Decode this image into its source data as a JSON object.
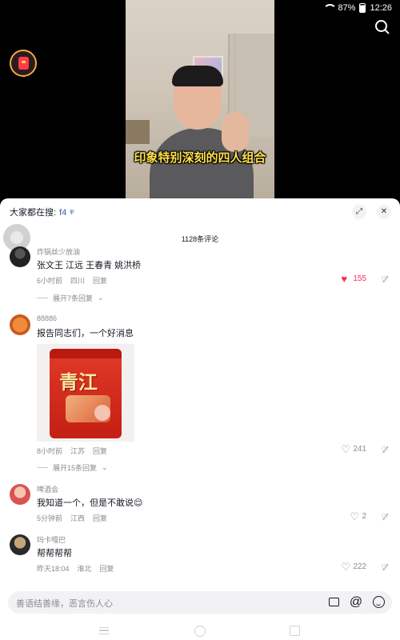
{
  "status": {
    "battery": "87%",
    "time": "12:26"
  },
  "video": {
    "subtitle": "印象特别深刻的四人组合"
  },
  "panel": {
    "search_prefix": "大家都在搜:",
    "search_keyword": "f4",
    "comment_count": "1128条评论"
  },
  "comments": [
    {
      "user": "炸锅丝少放油",
      "text": "张文王 江远 王春青 姚洪桥",
      "time": "6小时前",
      "location": "四川",
      "reply": "回复",
      "likes": "155",
      "liked": true,
      "expand": "展开7条回复"
    },
    {
      "user": "88886",
      "text": "报告同志们，一个好消息",
      "time": "8小时前",
      "location": "江苏",
      "reply": "回复",
      "likes": "241",
      "liked": false,
      "expand": "展开15条回复",
      "image_brand": "青江"
    },
    {
      "user": "啤酒会",
      "text": "我知道一个，但是不敢说😌",
      "time": "5分钟前",
      "location": "江西",
      "reply": "回复",
      "likes": "2",
      "liked": false
    },
    {
      "user": "玛卡嘎巴",
      "text": "帮帮帮帮",
      "time": "昨天18:04",
      "location": "淮北",
      "reply": "回复",
      "likes": "222",
      "liked": false
    }
  ],
  "input": {
    "placeholder": "善语结善缘，恶言伤人心"
  },
  "icons": {
    "heart_filled": "heart-icon",
    "heart_outline": "heart-outline-icon",
    "dislike": "dislike-icon",
    "image": "image-icon",
    "at": "at-icon",
    "emoji": "emoji-icon"
  },
  "colors": {
    "like_red": "#fe2c55",
    "keyword_blue": "#3b5aa8",
    "subtitle_yellow": "#ffe14a"
  }
}
